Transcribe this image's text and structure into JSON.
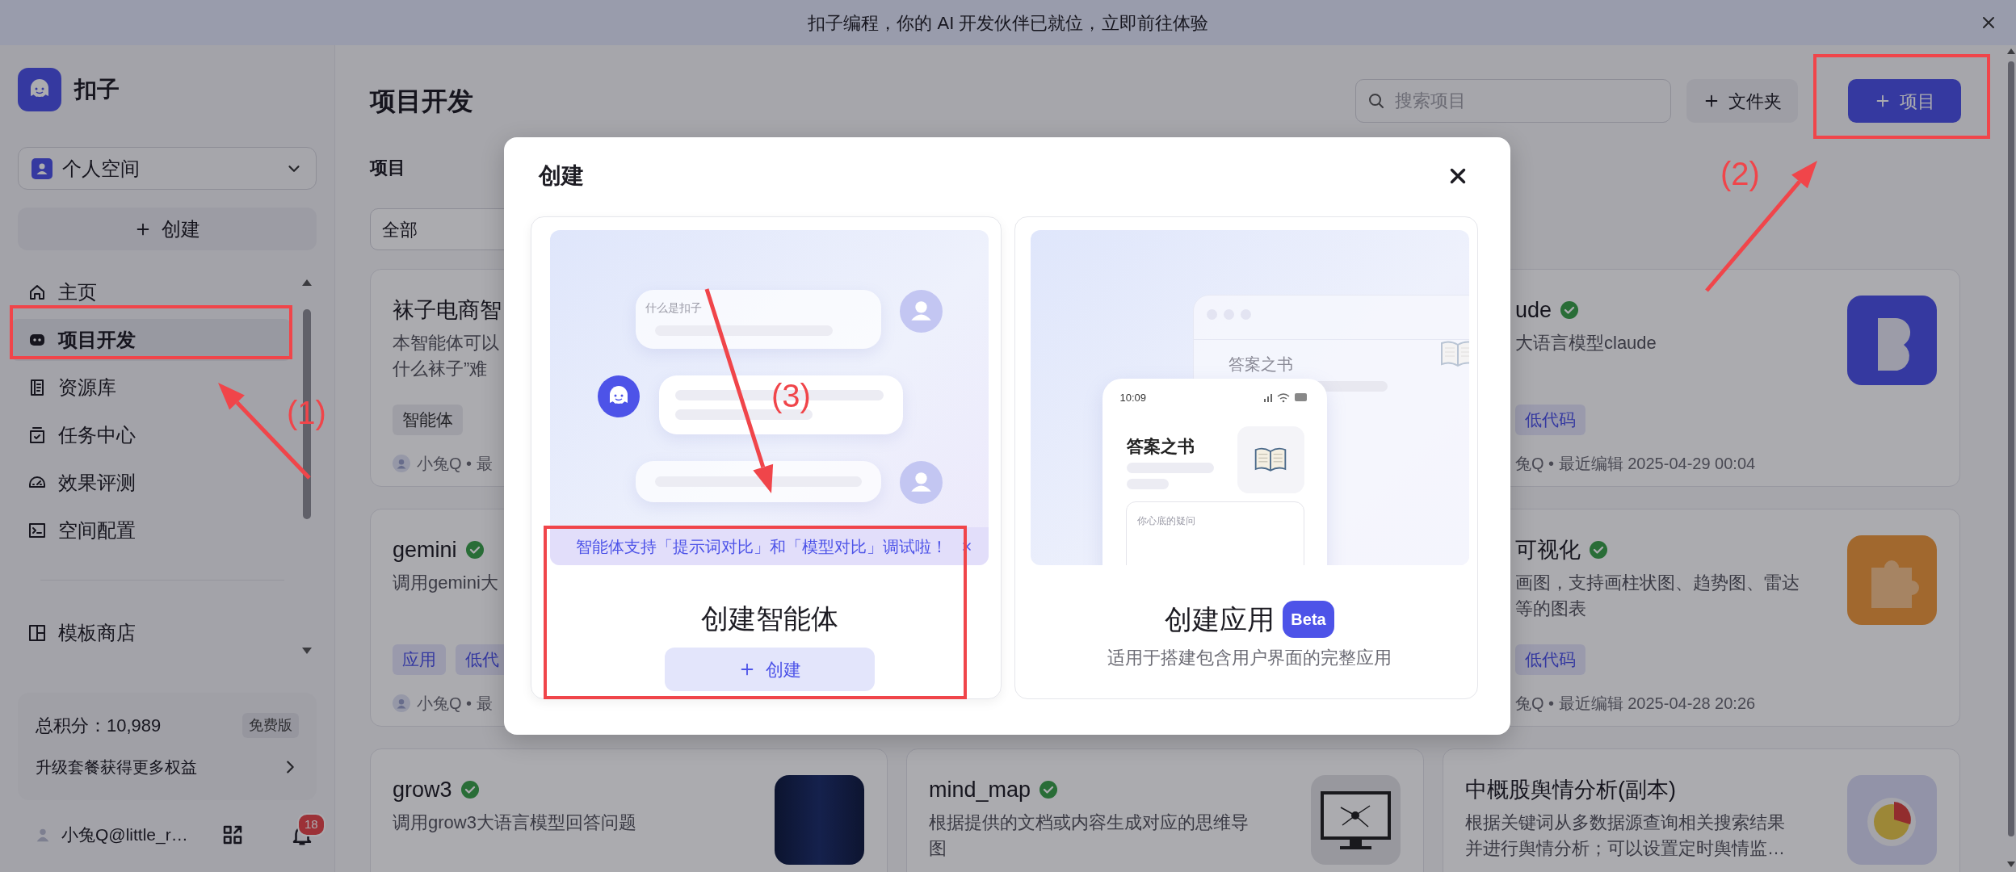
{
  "banner": {
    "message": "扣子编程，你的 AI 开发伙伴已就位，",
    "link": "立即前往体验"
  },
  "sidebar": {
    "brand": "扣子",
    "space": "个人空间",
    "create_button": "创建",
    "nav": [
      {
        "label": "主页",
        "selected": false
      },
      {
        "label": "项目开发",
        "selected": true
      },
      {
        "label": "资源库",
        "selected": false
      },
      {
        "label": "任务中心",
        "selected": false
      },
      {
        "label": "效果评测",
        "selected": false
      },
      {
        "label": "空间配置",
        "selected": false
      }
    ],
    "nav_extra": [
      {
        "label": "模板商店",
        "selected": false
      }
    ],
    "points": {
      "total": "总积分：10,989",
      "plan": "免费版",
      "upgrade": "升级套餐获得更多权益"
    },
    "user": {
      "name": "小兔Q@little_r…",
      "notifications": "18"
    }
  },
  "main": {
    "title": "项目开发",
    "search_placeholder": "搜索项目",
    "folder_button": "文件夹",
    "project_button": "项目",
    "filter_label": "项目",
    "filter_value": "全部",
    "cards": [
      {
        "title": "袜子电商智",
        "description": [
          "本智能体可以",
          "什么袜子”难"
        ],
        "tags": [
          {
            "label": "智能体",
            "kind": "agent"
          }
        ],
        "meta": "小兔Q • 最",
        "meta_avatar": true
      },
      {
        "title": "ude",
        "verified": true,
        "description": [
          "大语言模型claude"
        ],
        "tags": [
          {
            "label": "低代码",
            "kind": "low-code"
          }
        ],
        "meta": "兔Q • 最近编辑 2025-04-29 00:04",
        "meta_avatar": false,
        "thumbnail": {
          "kind": "letter-logo"
        }
      },
      {
        "title": "gemini",
        "verified": true,
        "description": [
          "调用gemini大"
        ],
        "tags": [
          {
            "label": "应用",
            "kind": "app"
          },
          {
            "label": "低代",
            "kind": "low-code"
          }
        ],
        "meta": "小兔Q • 最",
        "meta_avatar": true
      },
      {
        "title": "可视化",
        "verified": true,
        "description": [
          "画图，支持画柱状图、趋势图、雷达",
          "等的图表"
        ],
        "tags": [
          {
            "label": "低代码",
            "kind": "low-code"
          }
        ],
        "meta": "兔Q • 最近编辑 2025-04-28 20:26",
        "meta_avatar": false,
        "thumbnail": {
          "kind": "puzzle"
        }
      },
      {
        "title": "grow3",
        "verified": true,
        "description": [
          "调用grow3大语言模型回答问题"
        ],
        "thumbnail": {
          "kind": "dark-photo"
        }
      },
      {
        "title": "mind_map",
        "verified": true,
        "description": [
          "根据提供的文档或内容生成对应的思维导",
          "图"
        ],
        "thumbnail": {
          "kind": "monitor"
        }
      },
      {
        "title": "中概股舆情分析(副本)",
        "verified": false,
        "description": [
          "根据关键词从多数据源查询相关搜索结果",
          "并进行舆情分析；可以设置定时舆情监…"
        ],
        "thumbnail": {
          "kind": "pie-chart"
        }
      }
    ]
  },
  "modal": {
    "title": "创建",
    "options": [
      {
        "kind": "agent",
        "title": "创建智能体",
        "notice": "智能体支持「提示词对比」和「模型对比」调试啦！",
        "button": "创建",
        "question": "什么是扣子"
      },
      {
        "kind": "app",
        "title": "创建应用",
        "badge": "Beta",
        "description": "适用于搭建包含用户界面的完整应用",
        "window_title": "答案之书",
        "time": "10:09",
        "app_title": "答案之书",
        "input_hint": "你心底的疑问"
      }
    ]
  },
  "annotations": [
    {
      "label": "(1)"
    },
    {
      "label": "(2)"
    },
    {
      "label": "(3)"
    }
  ]
}
